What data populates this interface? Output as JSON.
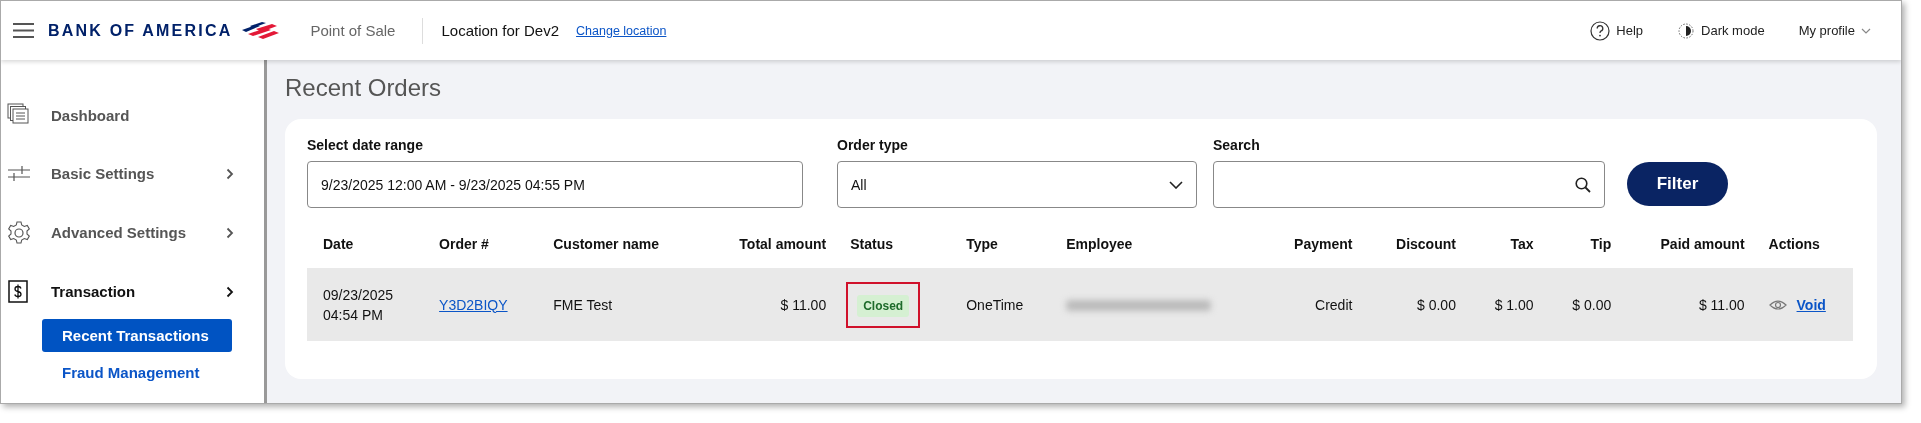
{
  "header": {
    "brand": "BANK OF AMERICA",
    "app_name": "Point of Sale",
    "location": "Location for Dev2",
    "change_location": "Change location",
    "help": "Help",
    "dark_mode": "Dark mode",
    "profile": "My profile"
  },
  "sidebar": {
    "items": [
      {
        "label": "Dashboard",
        "has_arrow": false,
        "active": false
      },
      {
        "label": "Basic Settings",
        "has_arrow": true,
        "active": false
      },
      {
        "label": "Advanced Settings",
        "has_arrow": true,
        "active": false
      },
      {
        "label": "Transaction",
        "has_arrow": true,
        "active": true,
        "children": [
          {
            "label": "Recent Transactions",
            "selected": true
          },
          {
            "label": "Fraud Management",
            "selected": false
          }
        ]
      }
    ]
  },
  "page_title": "Recent Orders",
  "filters": {
    "date_range": {
      "label": "Select date range",
      "value": "9/23/2025 12:00 AM - 9/23/2025 04:55 PM"
    },
    "order_type": {
      "label": "Order type",
      "value": "All"
    },
    "search": {
      "label": "Search"
    },
    "button": "Filter"
  },
  "table": {
    "columns": [
      "Date",
      "Order #",
      "Customer name",
      "Total amount",
      "Status",
      "Type",
      "Employee",
      "Payment",
      "Discount",
      "Tax",
      "Tip",
      "Paid amount",
      "Actions"
    ],
    "rows": [
      {
        "date": "09/23/2025\n04:54 PM",
        "order": "Y3D2BIQY",
        "customer": "FME Test",
        "total": "$ 11.00",
        "status": "Closed",
        "status_highlighted": true,
        "type": "OneTime",
        "employee_blurred": true,
        "payment": "Credit",
        "discount": "$ 0.00",
        "tax": "$ 1.00",
        "tip": "$ 0.00",
        "paid": "$ 11.00",
        "action": "Void"
      }
    ]
  }
}
